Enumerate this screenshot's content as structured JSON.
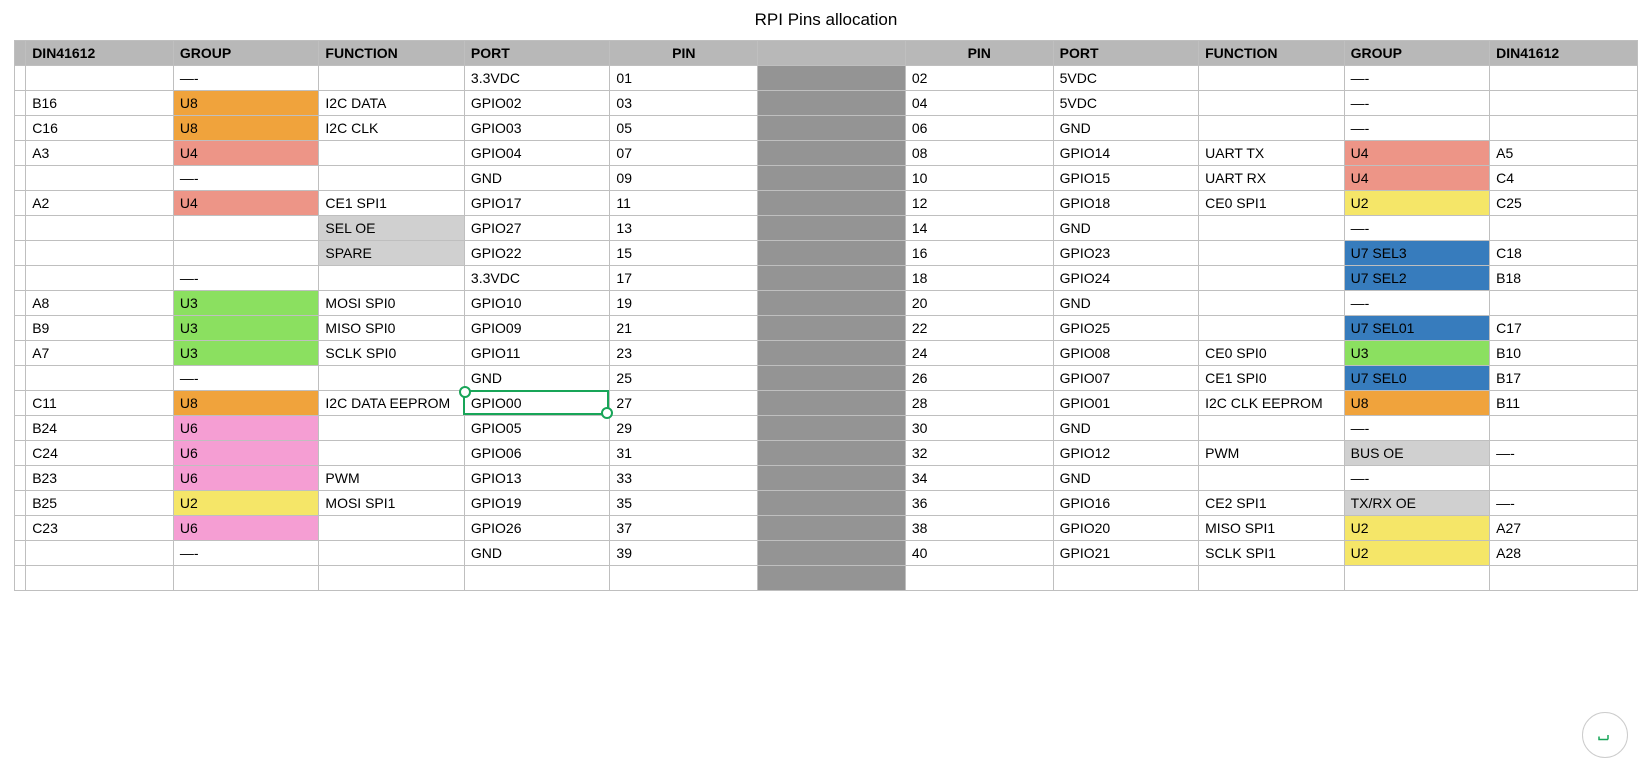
{
  "title": "RPI Pins allocation",
  "placeholder_dash": "—-",
  "headers": {
    "din": "DIN41612",
    "group": "GROUP",
    "func": "FUNCTION",
    "port": "PORT",
    "pin": "PIN"
  },
  "colors": {
    "orange": "#f0a33c",
    "salmon": "#ed9587",
    "lgray": "#d0d0d0",
    "green": "#8be060",
    "pink": "#f59ed3",
    "yellow": "#f5e668",
    "blue": "#377cbd"
  },
  "rows": [
    {
      "L": {
        "din": "",
        "group": "—-",
        "groupColor": "",
        "func": "",
        "funcColor": "",
        "port": "3.3VDC",
        "pin": "01"
      },
      "R": {
        "pin": "02",
        "port": "5VDC",
        "func": "",
        "group": "—-",
        "groupColor": "",
        "din": ""
      }
    },
    {
      "L": {
        "din": "B16",
        "group": "U8",
        "groupColor": "orange",
        "func": "I2C DATA",
        "funcColor": "",
        "port": "GPIO02",
        "pin": "03"
      },
      "R": {
        "pin": "04",
        "port": "5VDC",
        "func": "",
        "group": "—-",
        "groupColor": "",
        "din": ""
      }
    },
    {
      "L": {
        "din": "C16",
        "group": "U8",
        "groupColor": "orange",
        "func": "I2C CLK",
        "funcColor": "",
        "port": "GPIO03",
        "pin": "05"
      },
      "R": {
        "pin": "06",
        "port": "GND",
        "func": "",
        "group": "—-",
        "groupColor": "",
        "din": ""
      }
    },
    {
      "L": {
        "din": "A3",
        "group": "U4",
        "groupColor": "salmon",
        "func": "",
        "funcColor": "",
        "port": "GPIO04",
        "pin": "07"
      },
      "R": {
        "pin": "08",
        "port": "GPIO14",
        "func": "UART TX",
        "group": "U4",
        "groupColor": "salmon",
        "din": "A5"
      }
    },
    {
      "L": {
        "din": "",
        "group": "—-",
        "groupColor": "",
        "func": "",
        "funcColor": "",
        "port": "GND",
        "pin": "09"
      },
      "R": {
        "pin": "10",
        "port": "GPIO15",
        "func": "UART RX",
        "group": "U4",
        "groupColor": "salmon",
        "din": "C4"
      }
    },
    {
      "L": {
        "din": "A2",
        "group": "U4",
        "groupColor": "salmon",
        "func": "CE1 SPI1",
        "funcColor": "",
        "port": "GPIO17",
        "pin": "11"
      },
      "R": {
        "pin": "12",
        "port": "GPIO18",
        "func": "CE0 SPI1",
        "group": "U2",
        "groupColor": "yellow",
        "din": "C25"
      }
    },
    {
      "L": {
        "din": "",
        "group": "",
        "groupColor": "",
        "func": "SEL OE",
        "funcColor": "lgray",
        "port": "GPIO27",
        "pin": "13"
      },
      "R": {
        "pin": "14",
        "port": "GND",
        "func": "",
        "group": "—-",
        "groupColor": "",
        "din": ""
      }
    },
    {
      "L": {
        "din": "",
        "group": "",
        "groupColor": "",
        "func": "SPARE",
        "funcColor": "lgray",
        "port": "GPIO22",
        "pin": "15"
      },
      "R": {
        "pin": "16",
        "port": "GPIO23",
        "func": "",
        "group": "U7 SEL3",
        "groupColor": "blue",
        "din": "C18"
      }
    },
    {
      "L": {
        "din": "",
        "group": "—-",
        "groupColor": "",
        "func": "",
        "funcColor": "",
        "port": "3.3VDC",
        "pin": "17"
      },
      "R": {
        "pin": "18",
        "port": "GPIO24",
        "func": "",
        "group": "U7 SEL2",
        "groupColor": "blue",
        "din": "B18"
      }
    },
    {
      "L": {
        "din": "A8",
        "group": "U3",
        "groupColor": "green",
        "func": "MOSI SPI0",
        "funcColor": "",
        "port": "GPIO10",
        "pin": "19"
      },
      "R": {
        "pin": "20",
        "port": "GND",
        "func": "",
        "group": "—-",
        "groupColor": "",
        "din": ""
      }
    },
    {
      "L": {
        "din": "B9",
        "group": "U3",
        "groupColor": "green",
        "func": "MISO SPI0",
        "funcColor": "",
        "port": "GPIO09",
        "pin": "21"
      },
      "R": {
        "pin": "22",
        "port": "GPIO25",
        "func": "",
        "group": "U7 SEL01",
        "groupColor": "blue",
        "din": "C17"
      }
    },
    {
      "L": {
        "din": "A7",
        "group": "U3",
        "groupColor": "green",
        "func": "SCLK SPI0",
        "funcColor": "",
        "port": "GPIO11",
        "pin": "23"
      },
      "R": {
        "pin": "24",
        "port": "GPIO08",
        "func": "CE0 SPI0",
        "group": "U3",
        "groupColor": "green",
        "din": "B10"
      }
    },
    {
      "L": {
        "din": "",
        "group": "—-",
        "groupColor": "",
        "func": "",
        "funcColor": "",
        "port": "GND",
        "pin": "25"
      },
      "R": {
        "pin": "26",
        "port": "GPIO07",
        "func": "CE1 SPI0",
        "group": "U7 SEL0",
        "groupColor": "blue",
        "din": "B17"
      }
    },
    {
      "L": {
        "din": "C11",
        "group": "U8",
        "groupColor": "orange",
        "func": "I2C DATA EEPROM",
        "funcColor": "",
        "port": "GPIO00",
        "pin": "27"
      },
      "R": {
        "pin": "28",
        "port": "GPIO01",
        "func": "I2C CLK EEPROM",
        "group": "U8",
        "groupColor": "orange",
        "din": "B11"
      }
    },
    {
      "L": {
        "din": "B24",
        "group": "U6",
        "groupColor": "pink",
        "func": "",
        "funcColor": "",
        "port": "GPIO05",
        "pin": "29"
      },
      "R": {
        "pin": "30",
        "port": "GND",
        "func": "",
        "group": "—-",
        "groupColor": "",
        "din": ""
      }
    },
    {
      "L": {
        "din": "C24",
        "group": "U6",
        "groupColor": "pink",
        "func": "",
        "funcColor": "",
        "port": "GPIO06",
        "pin": "31"
      },
      "R": {
        "pin": "32",
        "port": "GPIO12",
        "func": "PWM",
        "group": "BUS OE",
        "groupColor": "lgray",
        "din": "—-"
      }
    },
    {
      "L": {
        "din": "B23",
        "group": "U6",
        "groupColor": "pink",
        "func": "PWM",
        "funcColor": "",
        "port": "GPIO13",
        "pin": "33"
      },
      "R": {
        "pin": "34",
        "port": "GND",
        "func": "",
        "group": "—-",
        "groupColor": "",
        "din": ""
      }
    },
    {
      "L": {
        "din": "B25",
        "group": "U2",
        "groupColor": "yellow",
        "func": "MOSI SPI1",
        "funcColor": "",
        "port": "GPIO19",
        "pin": "35"
      },
      "R": {
        "pin": "36",
        "port": "GPIO16",
        "func": "CE2 SPI1",
        "group": "TX/RX OE",
        "groupColor": "lgray",
        "din": "—-"
      }
    },
    {
      "L": {
        "din": "C23",
        "group": "U6",
        "groupColor": "pink",
        "func": "",
        "funcColor": "",
        "port": "GPIO26",
        "pin": "37"
      },
      "R": {
        "pin": "38",
        "port": "GPIO20",
        "func": "MISO SPI1",
        "group": "U2",
        "groupColor": "yellow",
        "din": "A27"
      }
    },
    {
      "L": {
        "din": "",
        "group": "—-",
        "groupColor": "",
        "func": "",
        "funcColor": "",
        "port": "GND",
        "pin": "39"
      },
      "R": {
        "pin": "40",
        "port": "GPIO21",
        "func": "SCLK SPI1",
        "group": "U2",
        "groupColor": "yellow",
        "din": "A28"
      }
    },
    {
      "L": {
        "din": "",
        "group": "",
        "groupColor": "",
        "func": "",
        "funcColor": "",
        "port": "",
        "pin": ""
      },
      "R": {
        "pin": "",
        "port": "",
        "func": "",
        "group": "",
        "groupColor": "",
        "din": ""
      }
    }
  ],
  "selection": {
    "rowIndex": 13,
    "side": "L",
    "field": "port"
  }
}
